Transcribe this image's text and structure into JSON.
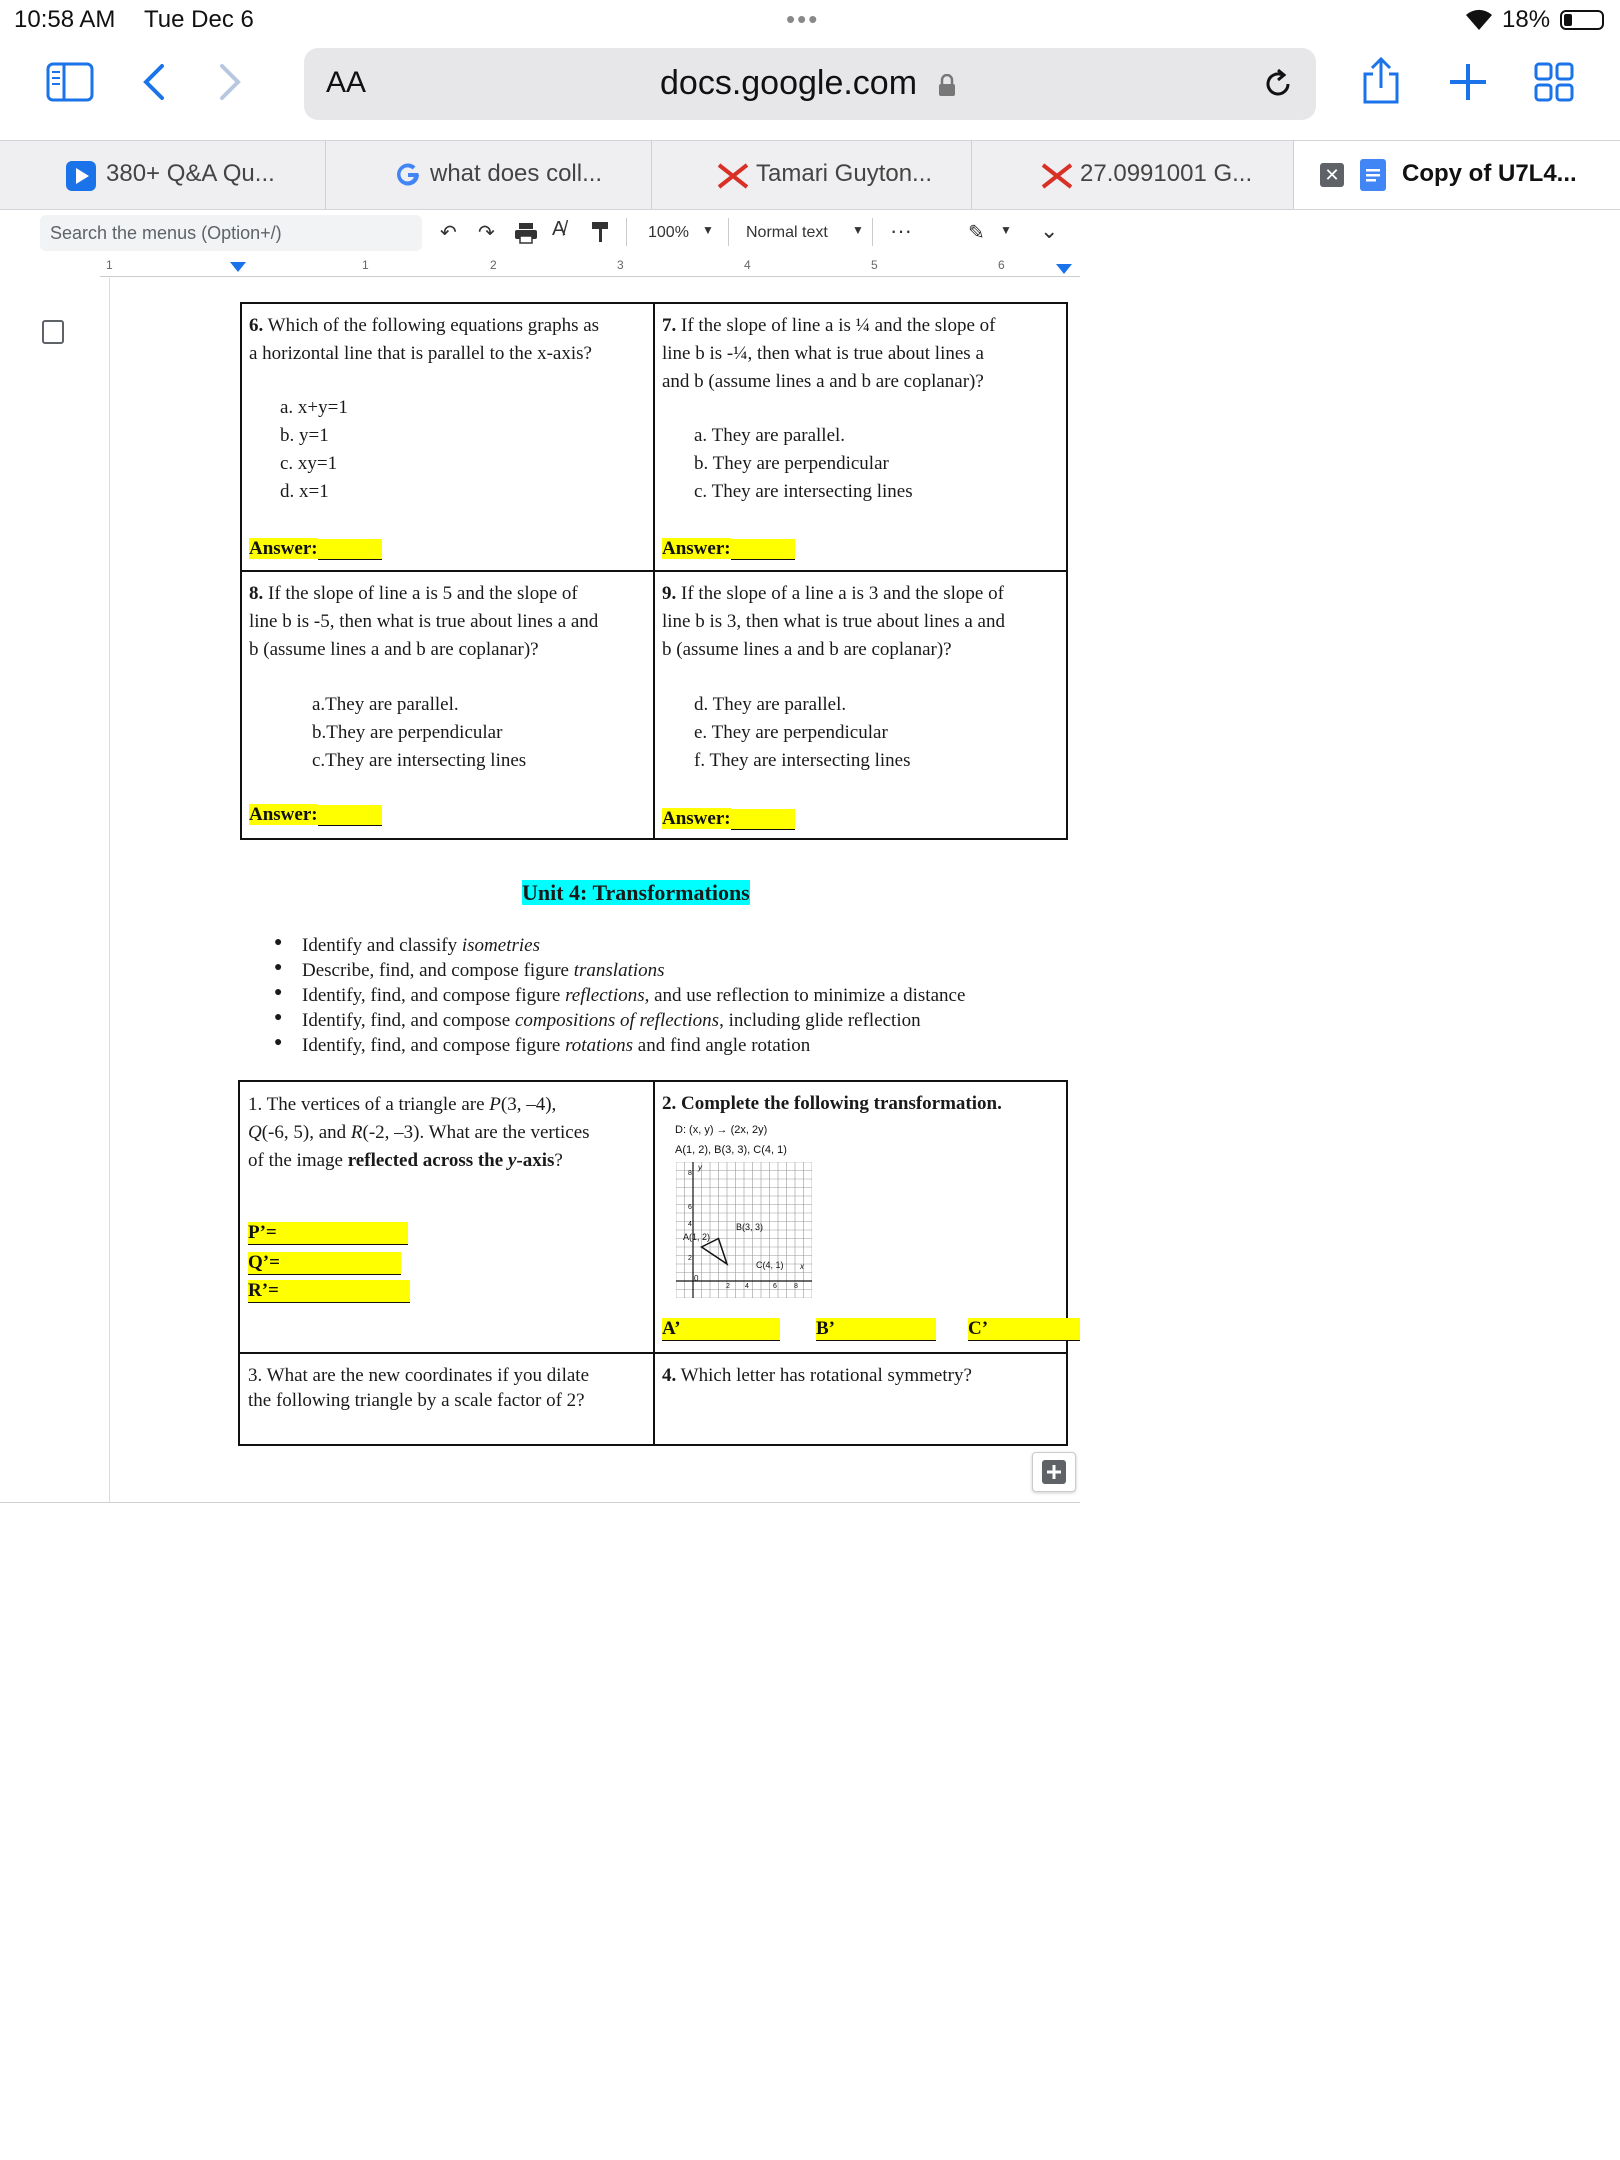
{
  "status_bar": {
    "time": "10:58 AM",
    "date": "Tue Dec 6",
    "battery": "18%"
  },
  "browser": {
    "text_size_label": "AA",
    "url": "docs.google.com",
    "tabs": [
      {
        "label": "380+ Q&A Qu..."
      },
      {
        "label": "what does coll..."
      },
      {
        "label": "Tamari Guyton..."
      },
      {
        "label": "27.0991001 G..."
      },
      {
        "label": "Copy of U7L4..."
      }
    ]
  },
  "docs_toolbar": {
    "search_placeholder": "Search the menus (Option+/)",
    "zoom": "100%",
    "style": "Normal text",
    "more": "···"
  },
  "ruler": {
    "labels": [
      "1",
      "1",
      "2",
      "3",
      "4",
      "5",
      "6"
    ]
  },
  "document": {
    "q6": {
      "number": "6.",
      "text_a": "Which of the following equations graphs as",
      "text_b": "a horizontal line that is parallel to the x-axis?",
      "options": [
        "a.  x+y=1",
        "b.  y=1",
        "c.  xy=1",
        "d.  x=1"
      ],
      "answer": "Answer:"
    },
    "q7": {
      "number": "7.",
      "text_a": "If the slope of line a is ¼ and the slope of",
      "text_b": "line b is -¼, then what is true about lines a",
      "text_c": "and b (assume lines a and b are coplanar)?",
      "options": [
        "a.  They are parallel.",
        "b.  They are perpendicular",
        "c.  They are intersecting lines"
      ],
      "answer": "Answer:"
    },
    "q8": {
      "number": "8.",
      "text_a": "If the slope of line a is 5 and the slope of",
      "text_b": "line b is -5, then what is true about lines a and",
      "text_c": "b (assume lines a and b are coplanar)?",
      "options": [
        "a.They are parallel.",
        "b.They are perpendicular",
        "c.They are intersecting lines"
      ],
      "answer": "Answer:"
    },
    "q9": {
      "number": "9.",
      "text_a": "If the slope of a line a is 3 and the slope of",
      "text_b": "line b is 3, then what is true about lines a and",
      "text_c": "b (assume lines a and b are coplanar)?",
      "options": [
        "d.  They are parallel.",
        "e.  They are perpendicular",
        "f.  They are intersecting lines"
      ],
      "answer": "Answer:"
    },
    "unit_title": "Unit 4: Transformations",
    "bullets": [
      [
        "Identify and classify ",
        "isometries",
        ""
      ],
      [
        "Describe, find, and compose figure ",
        "translations",
        ""
      ],
      [
        "Identify, find, and compose figure ",
        "reflections",
        ", and use reflection to minimize a distance"
      ],
      [
        "Identify, find, and compose ",
        "compositions of reflections",
        ", including glide reflection"
      ],
      [
        "Identify, find, and compose figure ",
        "rotations",
        " and find angle rotation"
      ]
    ],
    "t1": {
      "line1_a": "1. The vertices of a triangle are ",
      "line1_b": "P",
      "line1_c": "(3, –4),",
      "line2_a": "Q",
      "line2_b": "(-6, 5), and ",
      "line2_c": "R",
      "line2_d": "(-2, –3). What are the vertices",
      "line3_a": "of the image ",
      "line3_b": "reflected across the ",
      "line3_c": "y",
      "line3_d": "-axis",
      "line3_e": "?",
      "answers": [
        "P’=",
        "Q’=",
        "R’="
      ]
    },
    "t2": {
      "title": "2. Complete the following transformation.",
      "rule": "D: (x, y) → (2x, 2y)",
      "points": "A(1, 2), B(3, 3), C(4, 1)",
      "graph_labels": {
        "a": "A(1, 2)",
        "b": "B(3, 3)",
        "c": "C(4, 1)",
        "origin": "0",
        "y": "y",
        "x": "x",
        "ticks": [
          "8",
          "6",
          "4",
          "2",
          "2",
          "4",
          "6",
          "8"
        ]
      },
      "answers": [
        "A’",
        "B’",
        "C’"
      ]
    },
    "t3": {
      "line1": "3. What are the new coordinates if you dilate",
      "line2": "the following triangle by a scale factor of 2?"
    },
    "t4": {
      "number": "4.",
      "text": "Which letter has rotational symmetry?"
    }
  }
}
